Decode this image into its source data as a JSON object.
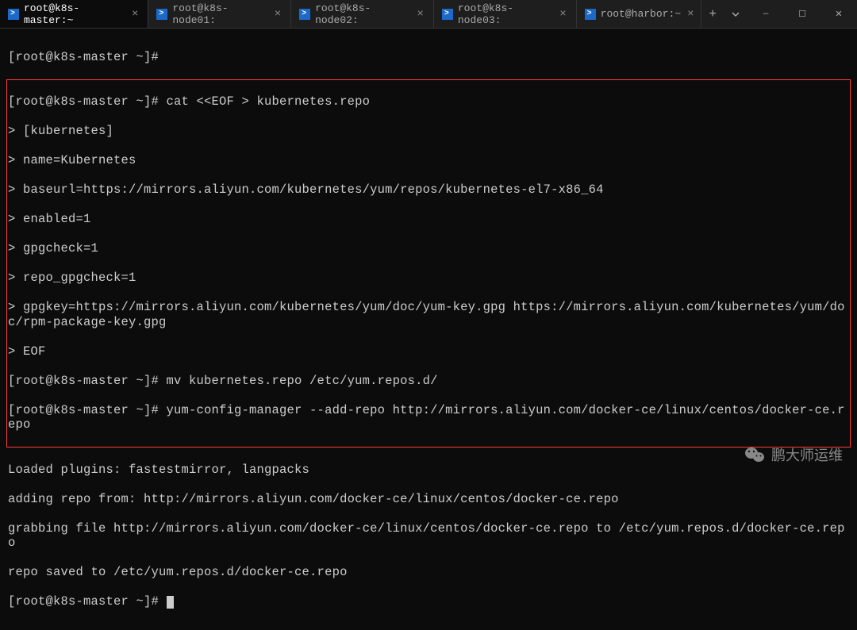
{
  "tabs": [
    {
      "label": "root@k8s-master:~",
      "active": true
    },
    {
      "label": "root@k8s-node01:",
      "active": false
    },
    {
      "label": "root@k8s-node02:",
      "active": false
    },
    {
      "label": "root@k8s-node03:",
      "active": false
    },
    {
      "label": "root@harbor:~",
      "active": false
    }
  ],
  "terminal": {
    "line0": "[root@k8s-master ~]#",
    "box": {
      "l1": "[root@k8s-master ~]# cat <<EOF > kubernetes.repo",
      "l2": "> [kubernetes]",
      "l3": "> name=Kubernetes",
      "l4": "> baseurl=https://mirrors.aliyun.com/kubernetes/yum/repos/kubernetes-el7-x86_64",
      "l5": "> enabled=1",
      "l6": "> gpgcheck=1",
      "l7": "> repo_gpgcheck=1",
      "l8": "> gpgkey=https://mirrors.aliyun.com/kubernetes/yum/doc/yum-key.gpg https://mirrors.aliyun.com/kubernetes/yum/doc/rpm-package-key.gpg",
      "l9": "> EOF",
      "l10": "[root@k8s-master ~]# mv kubernetes.repo /etc/yum.repos.d/",
      "l11": "[root@k8s-master ~]# yum-config-manager --add-repo http://mirrors.aliyun.com/docker-ce/linux/centos/docker-ce.repo"
    },
    "l12": "Loaded plugins: fastestmirror, langpacks",
    "l13": "adding repo from: http://mirrors.aliyun.com/docker-ce/linux/centos/docker-ce.repo",
    "l14": "grabbing file http://mirrors.aliyun.com/docker-ce/linux/centos/docker-ce.repo to /etc/yum.repos.d/docker-ce.repo",
    "l15": "repo saved to /etc/yum.repos.d/docker-ce.repo",
    "l16": "[root@k8s-master ~]# "
  },
  "watermark": "鹏大师运维",
  "icons": {
    "close": "×",
    "add": "+",
    "min": "—",
    "max": "☐",
    "x": "✕"
  }
}
